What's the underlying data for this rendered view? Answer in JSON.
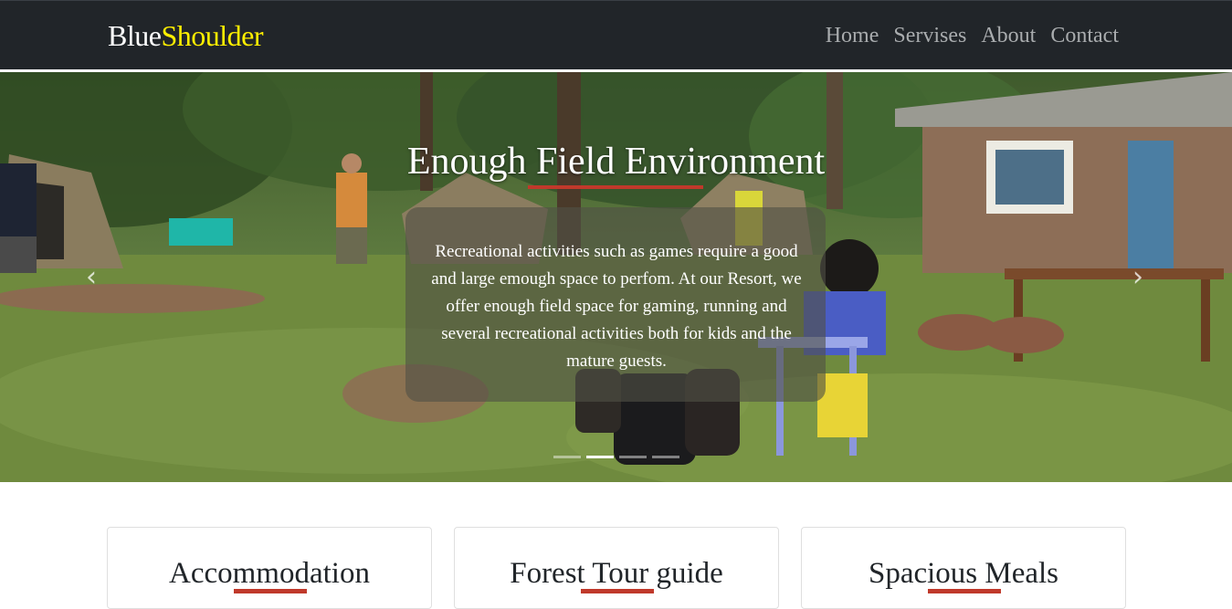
{
  "navbar": {
    "brand_part1": "Blue",
    "brand_part2": "Shoulder",
    "links": [
      "Home",
      "Servises",
      "About",
      "Contact"
    ]
  },
  "hero": {
    "title": "Enough Field Environment",
    "caption": "Recreational activities such as games require a good and large emough space to perfom. At our Resort, we offer enough field space for gaming, running and several recreational activities both for kids and the mature guests.",
    "prev_icon": "‹",
    "next_icon": "›",
    "slide_count": 4,
    "active_slide": 2
  },
  "cards": [
    {
      "title": "Accommodation"
    },
    {
      "title": "Forest Tour guide"
    },
    {
      "title": "Spacious Meals"
    }
  ],
  "colors": {
    "navbar_bg": "#212529",
    "brand_accent": "#ffef00",
    "underline_red": "#c0392b"
  }
}
